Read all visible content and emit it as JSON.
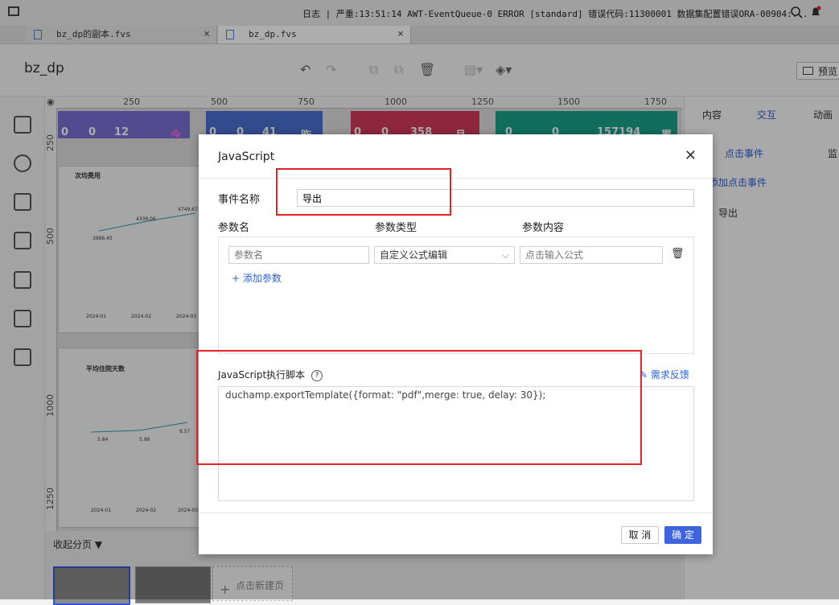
{
  "statusbar": {
    "log_label": "日志",
    "message": "| 严重:13:51:14 AWT-EventQueue-0 ERROR [standard] 错误代码:11300001 数据集配置错误ORA-00904:..."
  },
  "tabs": [
    {
      "label": "bz_dp的副本.fvs"
    },
    {
      "label": "bz_dp.fvs"
    }
  ],
  "header": {
    "title": "bz_dp",
    "preview_label": "预览"
  },
  "canvas": {
    "ruler_top": [
      "250",
      "500",
      "750",
      "1000",
      "1250",
      "1500",
      "1750"
    ],
    "ruler_left": [
      "250",
      "500",
      "1000",
      "1250"
    ],
    "kpis": [
      {
        "values": [
          "0",
          "0",
          "12"
        ],
        "badge": "今",
        "color": "#7b6fd4"
      },
      {
        "values": [
          "0",
          "0",
          "41"
        ],
        "badge": "昨",
        "color": "#4a6fd0"
      },
      {
        "values": [
          "0",
          "0",
          "358"
        ],
        "badge": "月",
        "color": "#d23a5a"
      },
      {
        "values": [
          "0",
          "0",
          "157194"
        ],
        "badge": "累",
        "color": "#1aa38a"
      }
    ],
    "chart1_title": "次均费用",
    "chart2_title": "平均住院天数",
    "chart1_points": [
      "3996.45",
      "4339.06",
      "4749.67"
    ],
    "chart2_points": [
      "5.84",
      "5.99",
      "6.57"
    ],
    "chart1_x": [
      "2024-01",
      "2024-02",
      "2024-03"
    ],
    "chart2_x": [
      "2024-01",
      "2024-02",
      "2024-03"
    ]
  },
  "bottom": {
    "collapse_label": "收起分页",
    "new_page_label": "点击新建页"
  },
  "rightpanel": {
    "tabs": [
      "内容",
      "交互",
      "动画"
    ],
    "subtabs": [
      "点击事件",
      "监"
    ],
    "add_event": "添加点击事件",
    "event_item": "导出"
  },
  "dialog": {
    "title": "JavaScript",
    "event_name_label": "事件名称",
    "event_name_value": "导出",
    "col_param_name": "参数名",
    "col_param_type": "参数类型",
    "col_param_content": "参数内容",
    "param_name_placeholder": "参数名",
    "param_type_value": "自定义公式编辑",
    "param_content_placeholder": "点击输入公式",
    "add_param": "添加参数",
    "script_label": "JavaScript执行脚本",
    "feedback": "需求反馈",
    "script": "duchamp.exportTemplate({format: \"pdf\",merge: true, delay: 30});",
    "cancel": "取 消",
    "ok": "确 定"
  }
}
